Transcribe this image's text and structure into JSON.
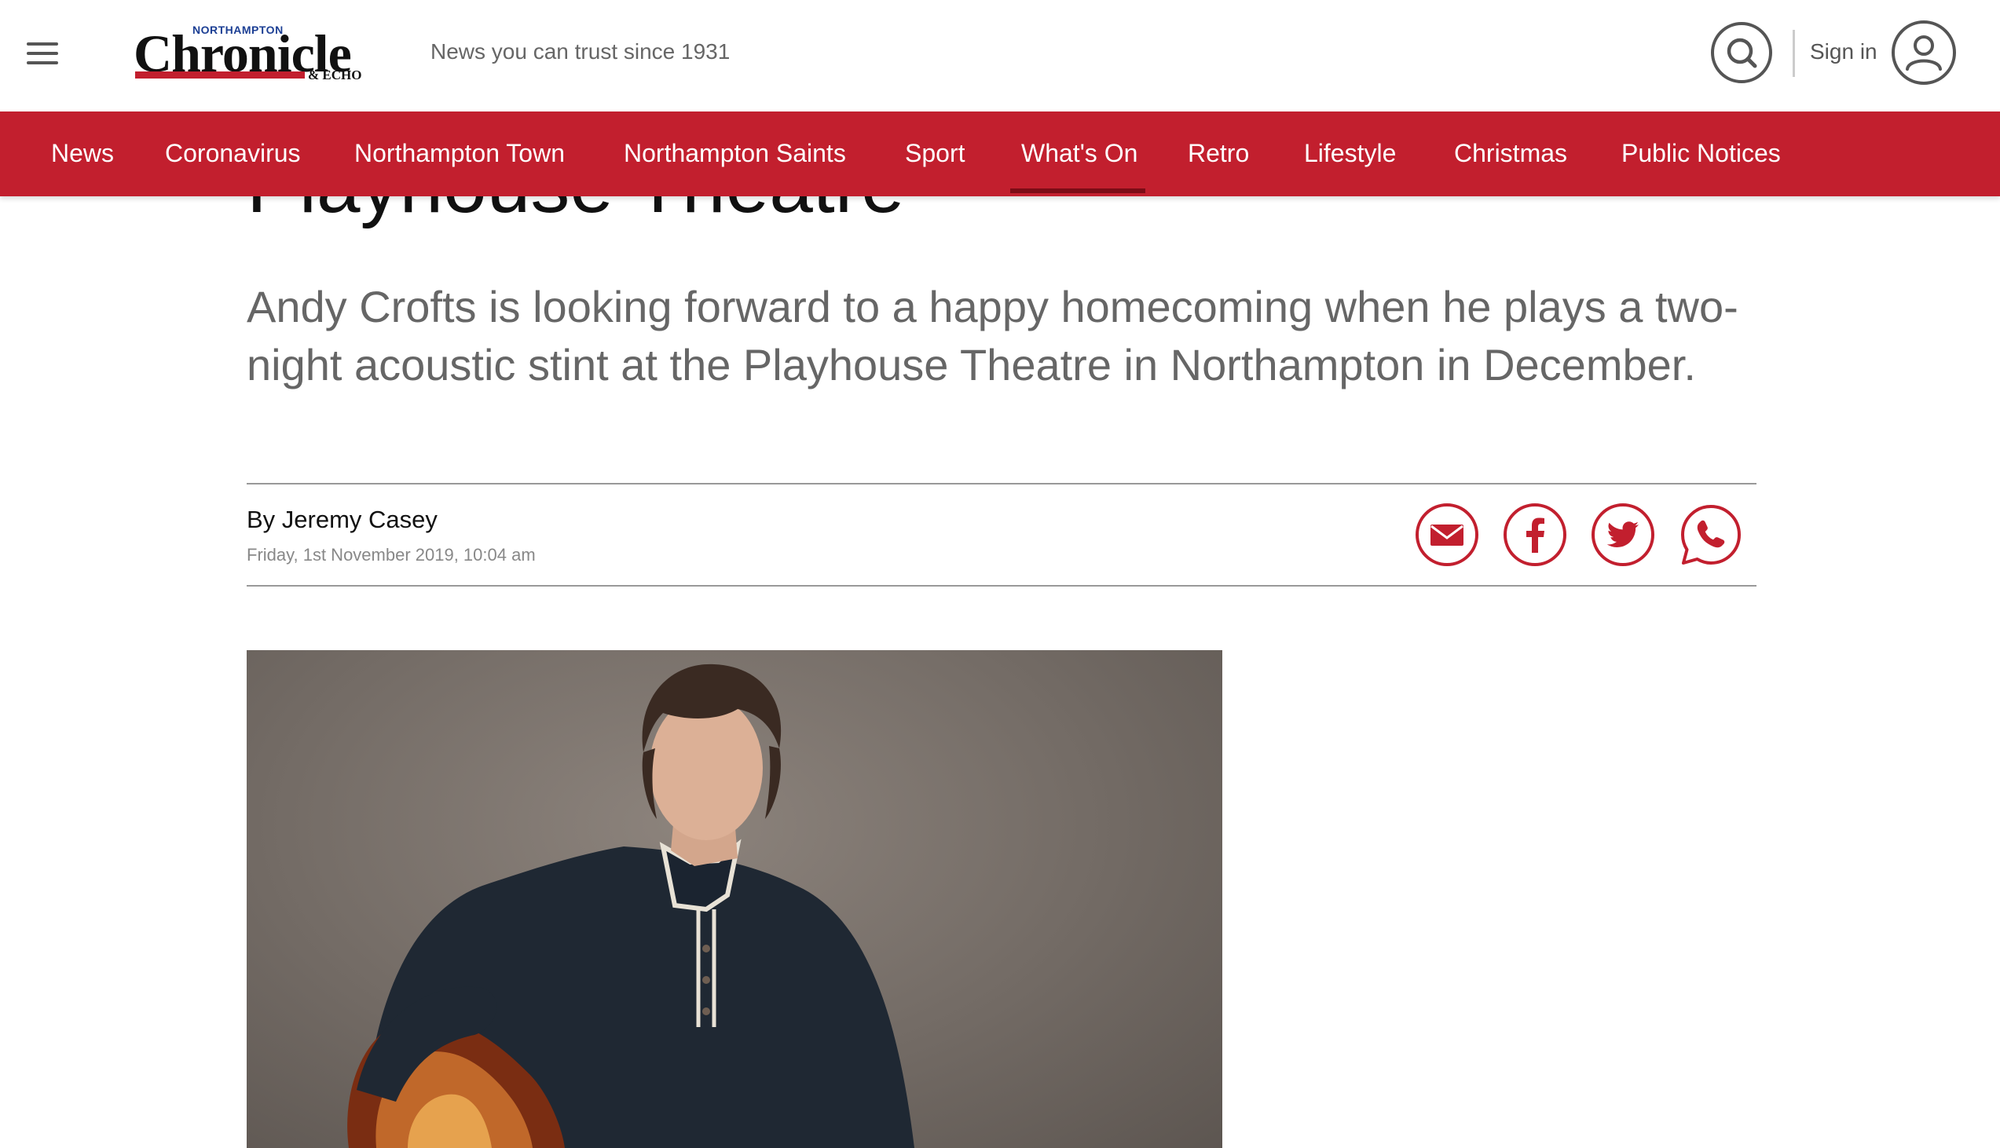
{
  "header": {
    "logo": {
      "top_text": "NORTHAMPTON",
      "main_text": "Chronicle",
      "sub_text": "& ECHO"
    },
    "tagline": "News you can trust since 1931",
    "sign_in": "Sign in"
  },
  "nav": {
    "items": [
      {
        "label": "News"
      },
      {
        "label": "Coronavirus"
      },
      {
        "label": "Northampton Town"
      },
      {
        "label": "Northampton Saints"
      },
      {
        "label": "Sport"
      },
      {
        "label": "What's On",
        "active": true
      },
      {
        "label": "Retro"
      },
      {
        "label": "Lifestyle"
      },
      {
        "label": "Christmas"
      },
      {
        "label": "Public Notices"
      }
    ],
    "background_color": "#c21f2e"
  },
  "article": {
    "headline_visible_fragment": "Playhouse Theatre",
    "standfirst": "Andy Crofts is looking forward to a happy homecoming when he plays a two-night acoustic stint at the Playhouse Theatre in Northampton in December.",
    "byline": "By Jeremy Casey",
    "date": "Friday, 1st November 2019, 10:04 am",
    "share": [
      "email-icon",
      "facebook-icon",
      "twitter-icon",
      "whatsapp-icon"
    ],
    "share_color": "#c21f2e"
  }
}
